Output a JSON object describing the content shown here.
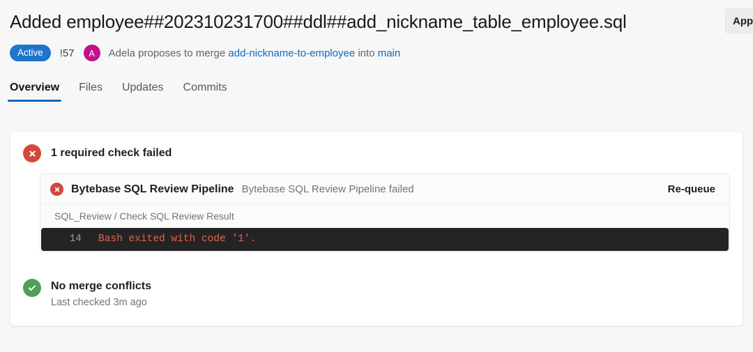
{
  "header": {
    "title": "Added employee##202310231700##ddl##add_nickname_table_employee.sql",
    "status_badge": "Active",
    "mr_iid": "!57",
    "avatar_initial": "A",
    "merge_prefix": "Adela proposes to merge",
    "source_branch": "add-nickname-to-employee",
    "merge_into": "into",
    "target_branch": "main",
    "approve_button": "Approve",
    "accent_blue": "#1f75cb",
    "link_blue": "#1068bf",
    "avatar_color": "#c3108c"
  },
  "tabs": [
    {
      "label": "Overview",
      "active": true
    },
    {
      "label": "Files",
      "active": false
    },
    {
      "label": "Updates",
      "active": false
    },
    {
      "label": "Commits",
      "active": false
    }
  ],
  "checks": {
    "summary_title": "1 required check failed",
    "summary_status": "failed",
    "failed_color": "#d4483c",
    "success_color": "#4ca154",
    "pipeline": {
      "name": "Bytebase SQL Review Pipeline",
      "description": "Bytebase SQL Review Pipeline failed",
      "action_label": "Re-queue",
      "job_path": "SQL_Review / Check SQL Review Result",
      "log": {
        "line_number": "14",
        "text": "Bash exited with code '1'.",
        "text_color": "#e8604d",
        "background": "#242424"
      }
    }
  },
  "merge_conflicts": {
    "title": "No merge conflicts",
    "subtitle": "Last checked 3m ago",
    "status": "success"
  }
}
